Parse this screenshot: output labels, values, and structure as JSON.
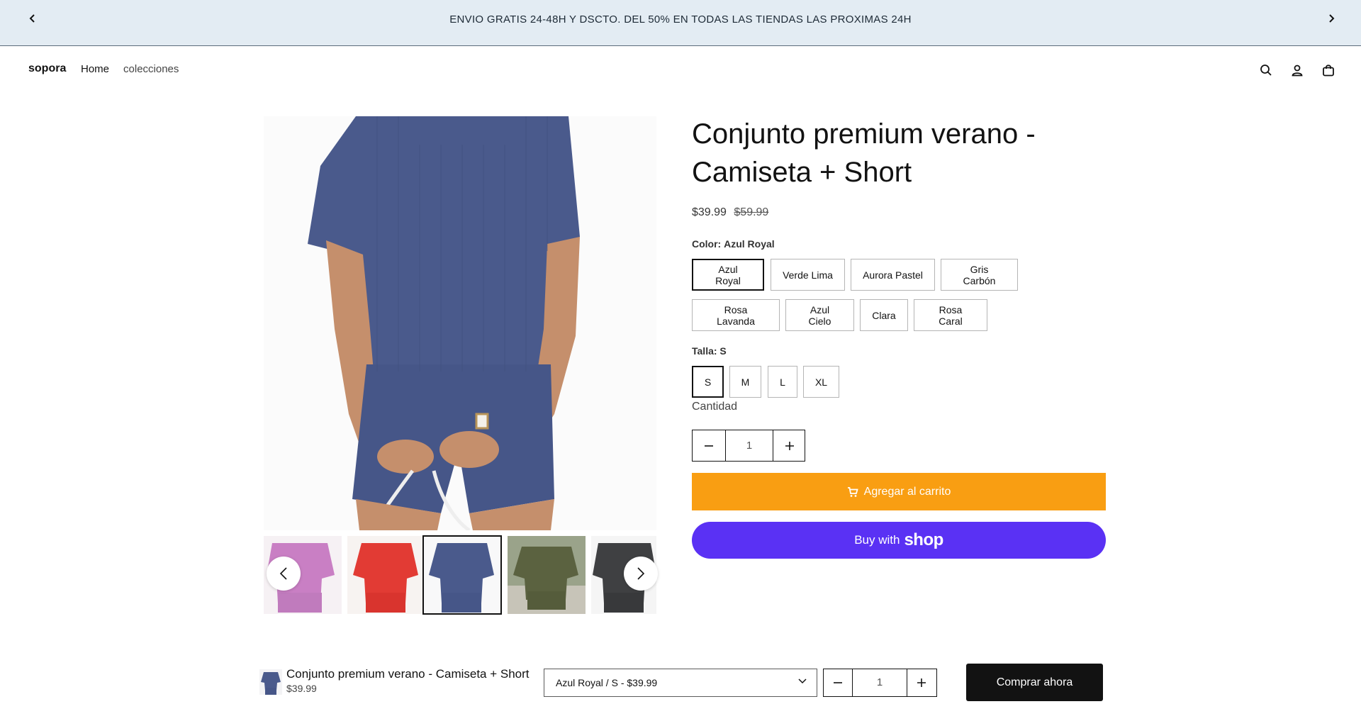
{
  "announcement": {
    "text": "ENVIO GRATIS 24-48H Y DSCTO. DEL 50% EN TODAS LAS TIENDAS LAS PROXIMAS 24H",
    "prev_icon": "chevron-left-icon",
    "next_icon": "chevron-right-icon"
  },
  "header": {
    "logo": "sopora",
    "nav": [
      {
        "label": "Home"
      },
      {
        "label": "colecciones"
      }
    ],
    "icons": [
      "search-icon",
      "account-icon",
      "cart-bag-icon"
    ]
  },
  "gallery": {
    "thumbnail_colors": [
      "#c97fc4",
      "#e23b34",
      "#4a5a8c",
      "#5b6240",
      "#3f4042"
    ],
    "active_thumbnail": 2,
    "prev_icon": "chevron-left-icon",
    "next_icon": "chevron-right-icon"
  },
  "product": {
    "title": "Conjunto premium verano - Camiseta + Short",
    "price": "$39.99",
    "compare_price": "$59.99",
    "color": {
      "label": "Color:",
      "selected": "Azul Royal",
      "options": [
        "Azul Royal",
        "Verde Lima",
        "Aurora Pastel",
        "Gris Carbón",
        "Rosa Lavanda",
        "Azul Cielo",
        "Clara",
        "Rosa Caral"
      ]
    },
    "size": {
      "label": "Talla:",
      "selected": "S",
      "options": [
        "S",
        "M",
        "L",
        "XL"
      ]
    },
    "quantity": {
      "label": "Cantidad",
      "value": "1"
    },
    "add_to_cart": "Agregar al carrito",
    "shop_pay": {
      "prefix": "Buy with",
      "brand": "shop"
    }
  },
  "sticky_bar": {
    "title": "Conjunto premium verano - Camiseta + Short",
    "price": "$39.99",
    "variant": "Azul Royal / S - $39.99",
    "quantity": "1",
    "buy_now": "Comprar ahora"
  },
  "colors": {
    "announcement_bg": "#e3ecf3",
    "add_to_cart_bg": "#f99e12",
    "shop_pay_bg": "#5a31f4",
    "buy_now_bg": "#121212",
    "product_blue": "#4a5a8c"
  }
}
